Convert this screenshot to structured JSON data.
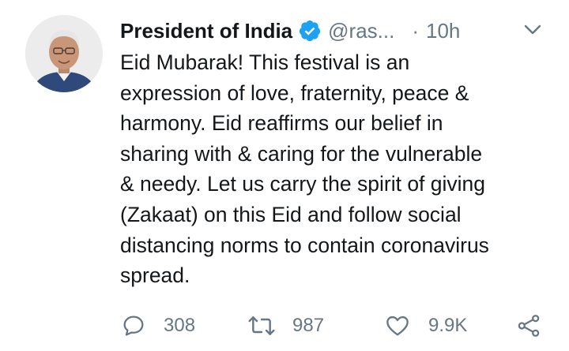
{
  "tweet": {
    "author_name": "President of India",
    "handle": "@ras...",
    "separator": "·",
    "time": "10h",
    "verified": true,
    "text_lines": [
      "Eid Mubarak! This festival is an",
      "expression of love, fraternity, peace &",
      "harmony. Eid reaffirms our belief in",
      "sharing with & caring for the vulnerable",
      "& needy. Let us carry the spirit of giving",
      "(Zakaat) on this Eid and follow social",
      "distancing norms to contain coronavirus",
      "spread."
    ]
  },
  "actions": {
    "reply_count": "308",
    "retweet_count": "987",
    "like_count": "9.9K"
  },
  "colors": {
    "text": "#14171a",
    "secondary": "#657786",
    "verified_blue": "#1da1f2"
  },
  "icons": {
    "verified": "verified-badge-icon",
    "caret": "chevron-down-icon",
    "reply": "reply-icon",
    "retweet": "retweet-icon",
    "like": "heart-icon",
    "share": "share-icon"
  }
}
